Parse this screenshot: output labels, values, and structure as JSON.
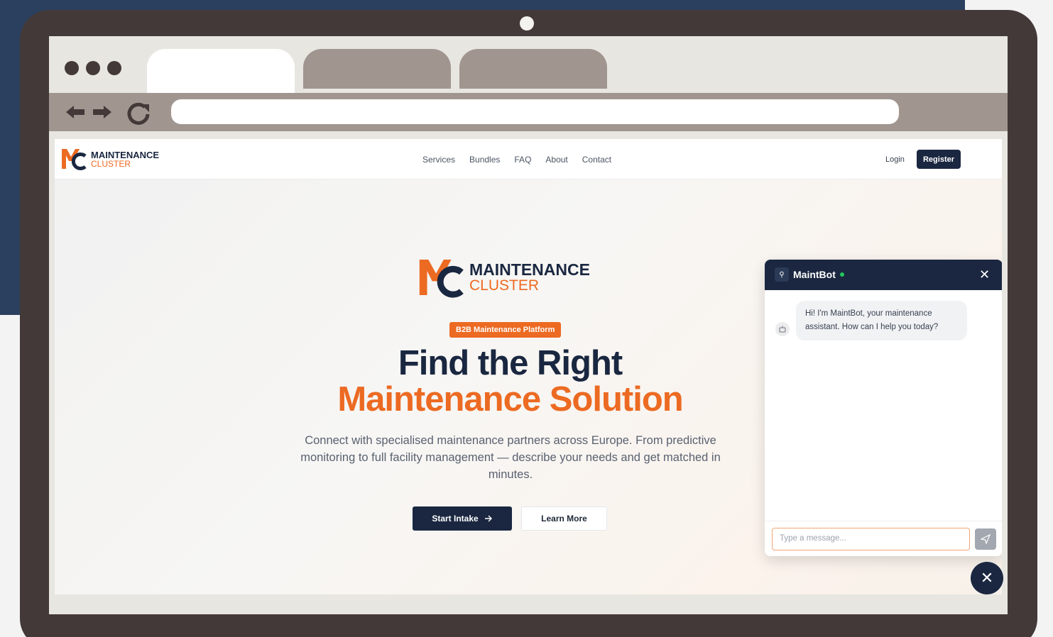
{
  "site": {
    "brand_top": "MAINTENANCE",
    "brand_bottom": "CLUSTER",
    "nav": [
      "Services",
      "Bundles",
      "FAQ",
      "About",
      "Contact"
    ],
    "login": "Login",
    "register": "Register"
  },
  "hero": {
    "badge": "B2B Maintenance Platform",
    "title_line1": "Find the Right",
    "title_line2": "Maintenance Solution",
    "subtitle": "Connect with specialised maintenance partners across Europe. From predictive monitoring to full facility management — describe your needs and get matched in minutes.",
    "start_button": "Start Intake",
    "learn_button": "Learn More"
  },
  "chat": {
    "title": "MaintBot",
    "message": "Hi! I'm MaintBot, your maintenance assistant. How can I help you today?",
    "input_placeholder": "Type a message..."
  },
  "colors": {
    "navy": "#1b2740",
    "orange": "#ec6a22",
    "laptop_frame": "#433938",
    "browser_chrome": "#a1958f"
  },
  "icons": [
    "back-arrow-icon",
    "forward-arrow-icon",
    "reload-icon",
    "bot-icon",
    "close-icon",
    "send-icon",
    "arrow-right-icon"
  ]
}
